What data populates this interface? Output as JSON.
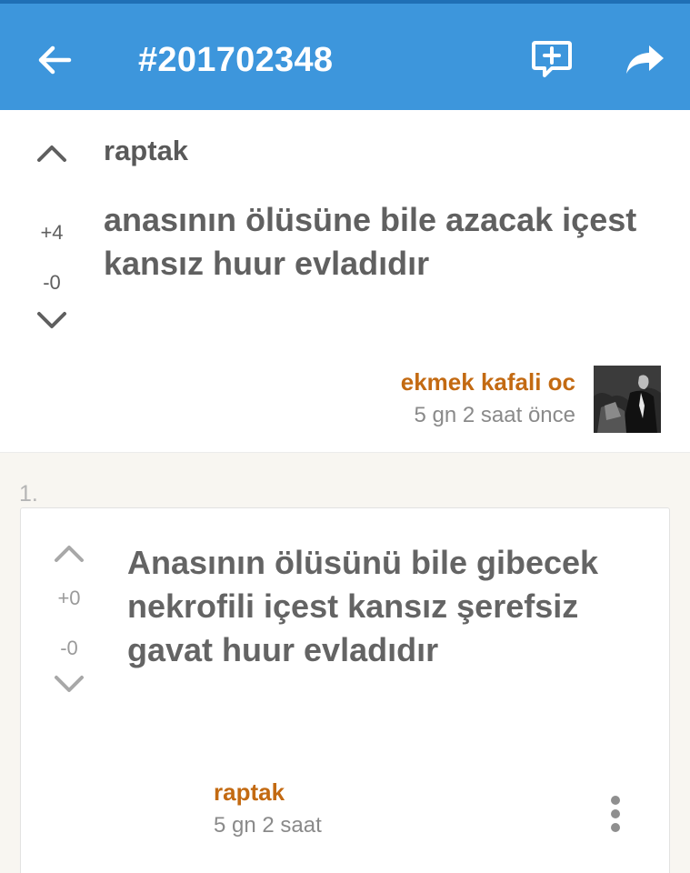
{
  "header": {
    "title": "#201702348",
    "back_icon": "arrow-left-icon",
    "reply_icon": "comment-add-icon",
    "share_icon": "share-icon",
    "color": "#3d96dc"
  },
  "post": {
    "title": "raptak",
    "body": "anasının ölüsüne bile azacak içest kansız huur evladıdır",
    "upvotes": "+4",
    "downvotes": "-0",
    "author": "ekmek kafali oc",
    "time": "5 gn 2 saat  önce",
    "author_color": "#c36a12"
  },
  "comments": [
    {
      "index": "1.",
      "upvotes": "+0",
      "downvotes": "-0",
      "body": "Anasının ölüsünü bile gibecek nekrofili içest kansız şerefsiz gavat huur evladıdır",
      "author": "raptak",
      "time": "5 gn 2 saat"
    }
  ]
}
